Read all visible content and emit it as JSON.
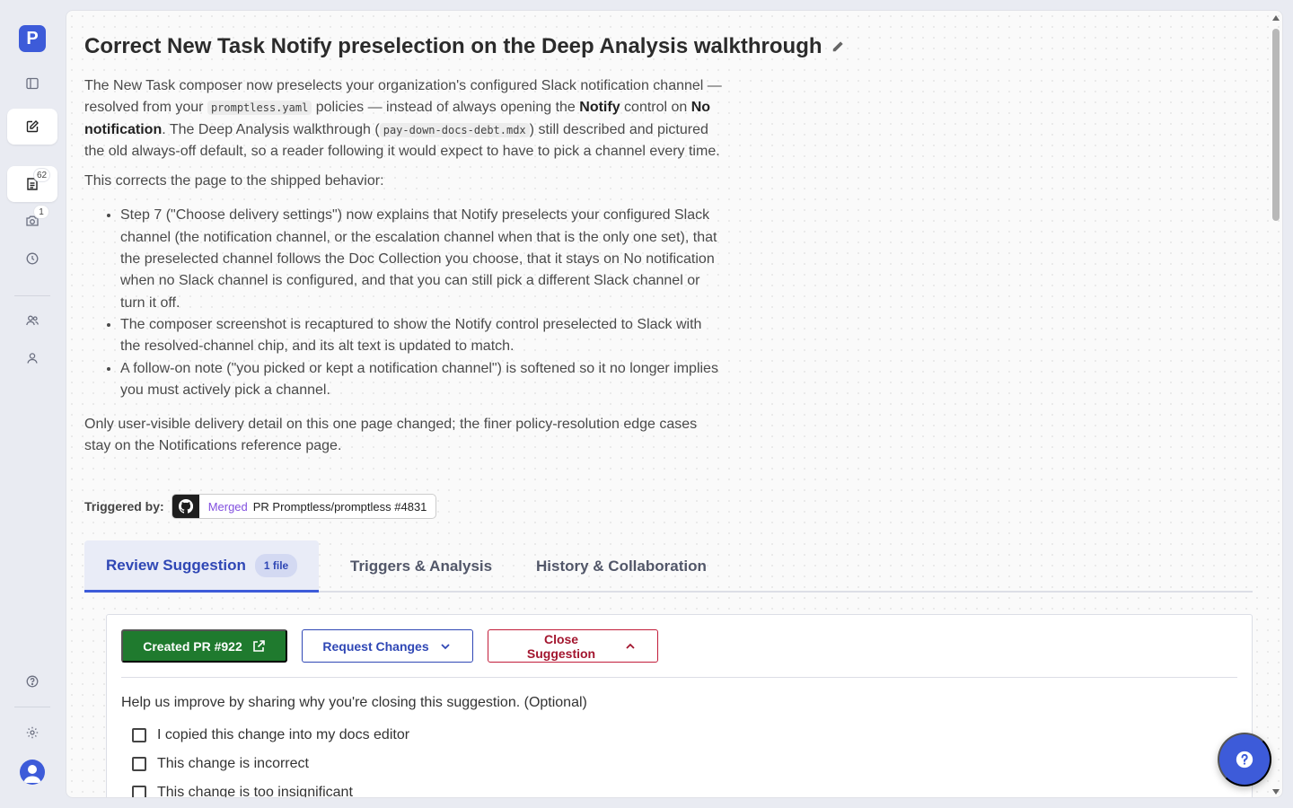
{
  "app": {
    "logo_letter": "P",
    "brand_color": "#3d5bd9"
  },
  "sidebar": {
    "items": [
      {
        "name": "sidebar-toggle",
        "icon": "sidebar-panel-icon"
      },
      {
        "name": "compose",
        "icon": "edit-icon",
        "active": true
      },
      {
        "name": "suggestions",
        "icon": "document-list-icon",
        "badge": "62"
      },
      {
        "name": "screenshots",
        "icon": "camera-icon",
        "badge": "1"
      },
      {
        "name": "history",
        "icon": "clock-icon"
      },
      {
        "name": "team",
        "icon": "users-icon"
      },
      {
        "name": "profile",
        "icon": "user-icon"
      },
      {
        "name": "help",
        "icon": "help-circle-icon"
      },
      {
        "name": "settings",
        "icon": "gear-icon"
      }
    ]
  },
  "suggestion": {
    "title": "Correct New Task Notify preselection on the Deep Analysis walkthrough",
    "desc1": {
      "a": "The New Task composer now preselects your organization's configured Slack notification channel — resolved from your ",
      "code1": "promptless.yaml",
      "b": " policies — instead of always opening the ",
      "bold1": "Notify",
      "c": " control on ",
      "bold2": "No notification",
      "d": ". The Deep Analysis walkthrough (",
      "code2": "pay-down-docs-debt.mdx",
      "e": ") still described and pictured the old always-off default, so a reader following it would expect to have to pick a channel every time."
    },
    "desc2": "This corrects the page to the shipped behavior:",
    "bullets": [
      "Step 7 (\"Choose delivery settings\") now explains that Notify preselects your configured Slack channel (the notification channel, or the escalation channel when that is the only one set), that the preselected channel follows the Doc Collection you choose, that it stays on No notification when no Slack channel is configured, and that you can still pick a different Slack channel or turn it off.",
      "The composer screenshot is recaptured to show the Notify control preselected to Slack with the resolved-channel chip, and its alt text is updated to match.",
      "A follow-on note (\"you picked or kept a notification channel\") is softened so it no longer implies you must actively pick a channel."
    ],
    "desc3": "Only user-visible delivery detail on this one page changed; the finer policy-resolution edge cases stay on the Notifications reference page.",
    "triggered_label": "Triggered by:",
    "trigger": {
      "status": "Merged",
      "pr": "PR Promptless/promptless #4831",
      "icon": "github-icon"
    }
  },
  "tabs": [
    {
      "label": "Review Suggestion",
      "badge": "1 file",
      "active": true
    },
    {
      "label": "Triggers & Analysis"
    },
    {
      "label": "History & Collaboration"
    }
  ],
  "review": {
    "created_pr": "Created PR #922",
    "request_changes": "Request Changes",
    "close_suggestion": "Close Suggestion",
    "close_prompt": "Help us improve by sharing why you're closing this suggestion. (Optional)",
    "reasons": [
      {
        "label": "I copied this change into my docs editor",
        "checked": false
      },
      {
        "label": "This change is incorrect",
        "checked": false
      },
      {
        "label": "This change is too insignificant",
        "checked": false
      }
    ]
  },
  "colors": {
    "accent": "#3d5bd9",
    "success": "#1f7a2e",
    "danger": "#c21d3a",
    "merged": "#8250df"
  }
}
